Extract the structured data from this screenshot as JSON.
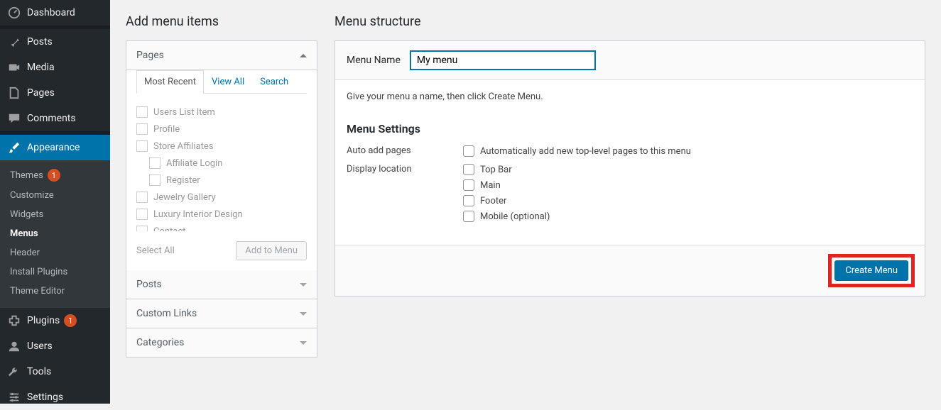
{
  "sidebar": {
    "items": [
      {
        "label": "Dashboard"
      },
      {
        "label": "Posts"
      },
      {
        "label": "Media"
      },
      {
        "label": "Pages"
      },
      {
        "label": "Comments"
      },
      {
        "label": "Appearance"
      },
      {
        "label": "Plugins",
        "badge": "1"
      },
      {
        "label": "Users"
      },
      {
        "label": "Tools"
      },
      {
        "label": "Settings"
      }
    ],
    "appearance_sub": [
      {
        "label": "Themes",
        "badge": "1"
      },
      {
        "label": "Customize"
      },
      {
        "label": "Widgets"
      },
      {
        "label": "Menus"
      },
      {
        "label": "Header"
      },
      {
        "label": "Install Plugins"
      },
      {
        "label": "Theme Editor"
      }
    ]
  },
  "left": {
    "heading": "Add menu items",
    "pages_label": "Pages",
    "tabs": {
      "recent": "Most Recent",
      "view_all": "View All",
      "search": "Search"
    },
    "page_items": [
      {
        "label": "Users List Item",
        "depth": 0
      },
      {
        "label": "Profile",
        "depth": 0
      },
      {
        "label": "Store Affiliates",
        "depth": 0
      },
      {
        "label": "Affiliate Login",
        "depth": 1
      },
      {
        "label": "Register",
        "depth": 1
      },
      {
        "label": "Jewelry Gallery",
        "depth": 0
      },
      {
        "label": "Luxury Interior Design",
        "depth": 0
      },
      {
        "label": "Contact",
        "depth": 0
      }
    ],
    "select_all": "Select All",
    "add_to_menu": "Add to Menu",
    "accordions": {
      "posts": "Posts",
      "custom_links": "Custom Links",
      "categories": "Categories"
    }
  },
  "right": {
    "heading": "Menu structure",
    "menu_name_label": "Menu Name",
    "menu_name_value": "My menu",
    "instruction": "Give your menu a name, then click Create Menu.",
    "settings_heading": "Menu Settings",
    "auto_add_label": "Auto add pages",
    "auto_add_opt": "Automatically add new top-level pages to this menu",
    "display_loc_label": "Display location",
    "locations": [
      "Top Bar",
      "Main",
      "Footer",
      "Mobile (optional)"
    ],
    "create_button": "Create Menu"
  }
}
